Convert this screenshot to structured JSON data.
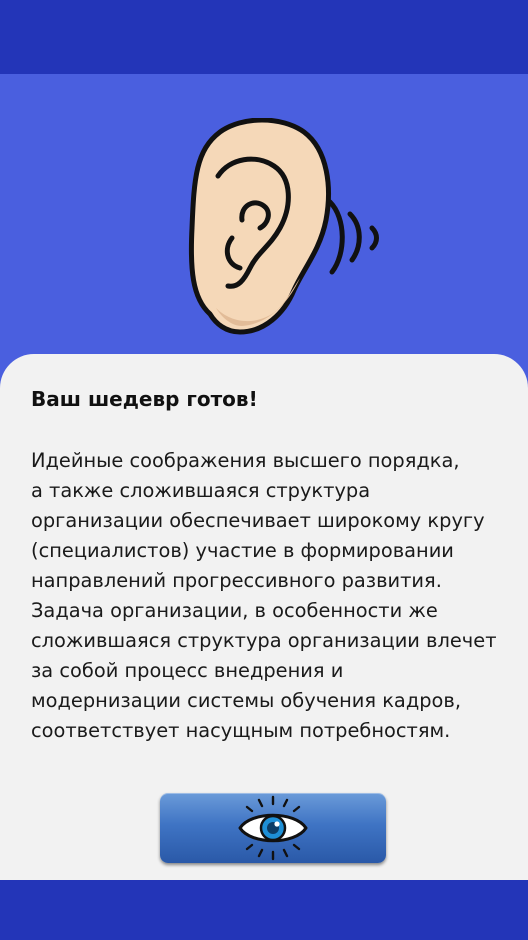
{
  "colors": {
    "top_bar": "#2335b8",
    "hero_background": "#4a5fdf",
    "card_background": "#f2f2f2",
    "bottom_bar": "#2335b8",
    "button_gradient_top": "#6b9bd9",
    "button_gradient_bottom": "#2a59a8",
    "eye_iris": "#1e8fd6"
  },
  "hero": {
    "icon": "ear-icon"
  },
  "card": {
    "title": "Ваш шедевр готов!",
    "body": "Идейные соображения высшего порядка,\nа также сложившаяся структура\nорганизации обеспечивает широкому кругу\n(специалистов) участие в формировании\nнаправлений прогрессивного развития.\nЗадача организации, в особенности же\nсложившаяся структура организации влечет\nза собой процесс внедрения и\nмодернизации системы обучения кадров,\nсоответствует насущным потребностям."
  },
  "view_button": {
    "icon": "eye-icon"
  }
}
